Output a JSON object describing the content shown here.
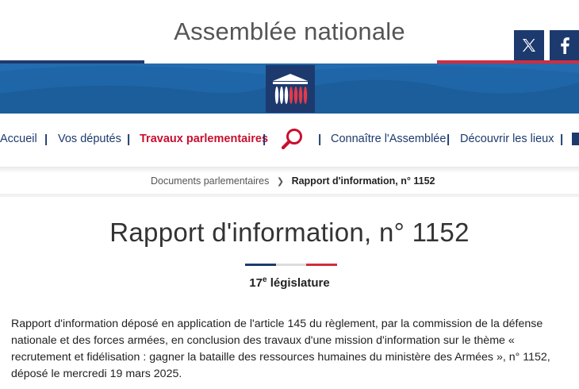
{
  "header": {
    "site_title": "Assemblée nationale",
    "social": [
      {
        "icon": "x-twitter-icon"
      },
      {
        "icon": "facebook-icon"
      }
    ],
    "colors": {
      "blue": "#1d3a6e",
      "banner": "#1f66a8",
      "red": "#d12d3f",
      "active": "#c8102e"
    }
  },
  "nav": {
    "items": [
      {
        "label": "Accueil"
      },
      {
        "label": "Vos députés"
      },
      {
        "label": "Travaux parlementaires",
        "active": true
      },
      {
        "label": "Connaître l'Assemblée"
      },
      {
        "label": "Découvrir les lieux"
      }
    ],
    "separator": "|",
    "search_icon": "search-icon"
  },
  "breadcrumb": {
    "parent": "Documents parlementaires",
    "current": "Rapport d'information, n° 1152"
  },
  "document": {
    "title": "Rapport d'information, n° 1152",
    "legislature_number": "17",
    "legislature_sup": "e",
    "legislature_label": "législature",
    "description": "Rapport d'information déposé en application de l'article 145 du règlement, par la commission de la défense nationale et des forces armées, en conclusion des travaux d'une mission d'information sur le thème « recrutement et fidélisation : gagner la bataille des ressources humaines du ministère des Armées », n° 1152, déposé le mercredi 19 mars 2025."
  }
}
